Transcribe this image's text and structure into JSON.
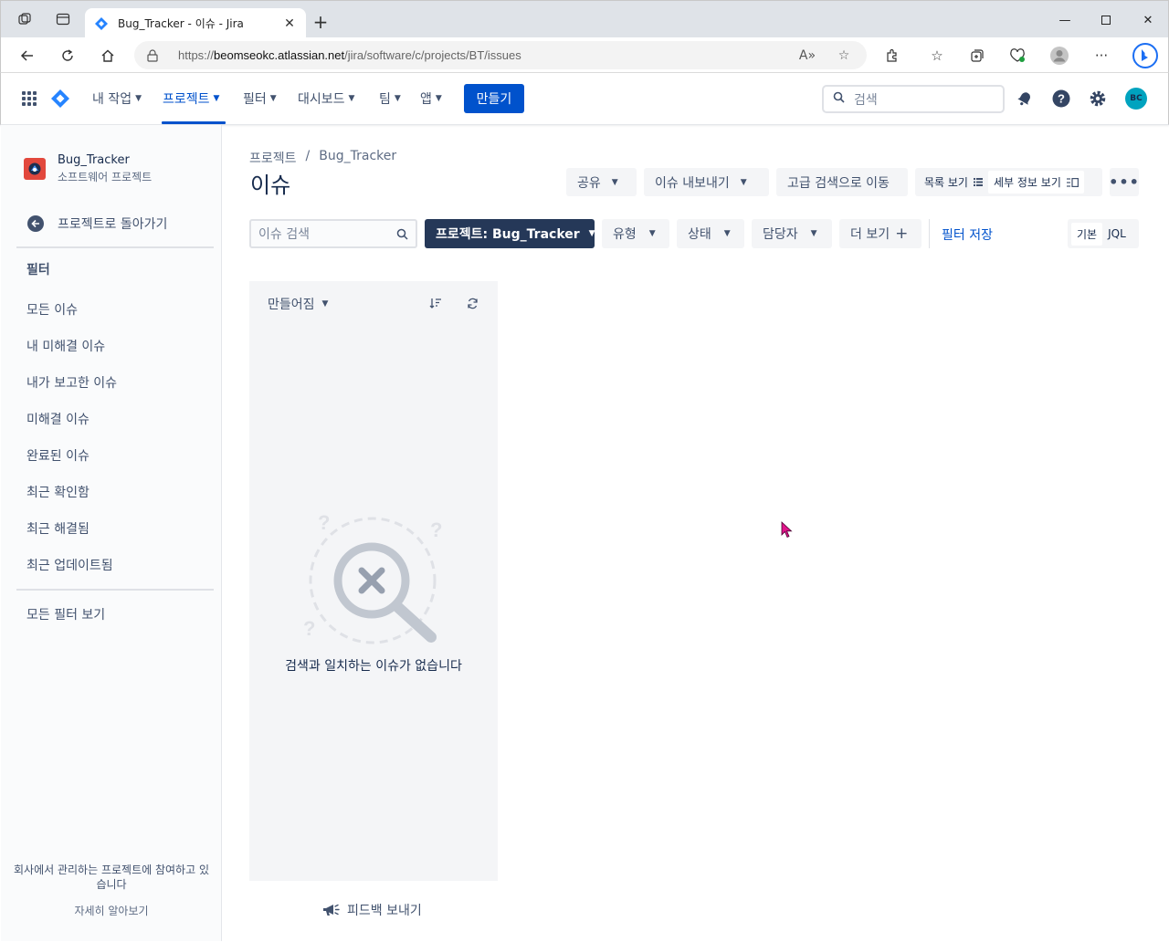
{
  "browser": {
    "tab_title": "Bug_Tracker - 이슈 - Jira",
    "url_prefix": "https://",
    "url_host": "beomseokc.atlassian.net",
    "url_path": "/jira/software/c/projects/BT/issues"
  },
  "topnav": {
    "your_work": "내 작업",
    "projects": "프로젝트",
    "filters": "필터",
    "dashboards": "대시보드",
    "teams": "팀",
    "apps": "앱",
    "create": "만들기",
    "search_placeholder": "검색",
    "avatar_initials": "BC"
  },
  "sidebar": {
    "project_name": "Bug_Tracker",
    "project_type": "소프트웨어 프로젝트",
    "back_label": "프로젝트로 돌아가기",
    "filters_heading": "필터",
    "items": [
      "모든 이슈",
      "내 미해결 이슈",
      "내가 보고한 이슈",
      "미해결 이슈",
      "완료된 이슈",
      "최근 확인함",
      "최근 해결됨",
      "최근 업데이트됨"
    ],
    "all_filters": "모든 필터 보기",
    "footer_text": "회사에서 관리하는 프로젝트에 참여하고 있습니다",
    "learn_more": "자세히 알아보기"
  },
  "main": {
    "breadcrumb_root": "프로젝트",
    "breadcrumb_sep": "/",
    "breadcrumb_project": "Bug_Tracker",
    "title": "이슈",
    "share": "공유",
    "export": "이슈 내보내기",
    "advanced_search": "고급 검색으로 이동",
    "list_view": "목록 보기",
    "detail_view": "세부 정보 보기",
    "search_placeholder": "이슈 검색",
    "filter_project": "프로젝트: Bug_Tracker",
    "filter_type": "유형",
    "filter_status": "상태",
    "filter_assignee": "담당자",
    "filter_more": "더 보기",
    "save_filter": "필터 저장",
    "mode_basic": "기본",
    "mode_jql": "JQL",
    "sort_label": "만들어짐",
    "empty_message": "검색과 일치하는 이슈가 없습니다",
    "feedback": "피드백 보내기"
  },
  "colors": {
    "brand_blue": "#0052cc",
    "dark_button": "#253858",
    "avatar_bg": "#00a3bf",
    "project_icon_bg": "#e2483d"
  }
}
